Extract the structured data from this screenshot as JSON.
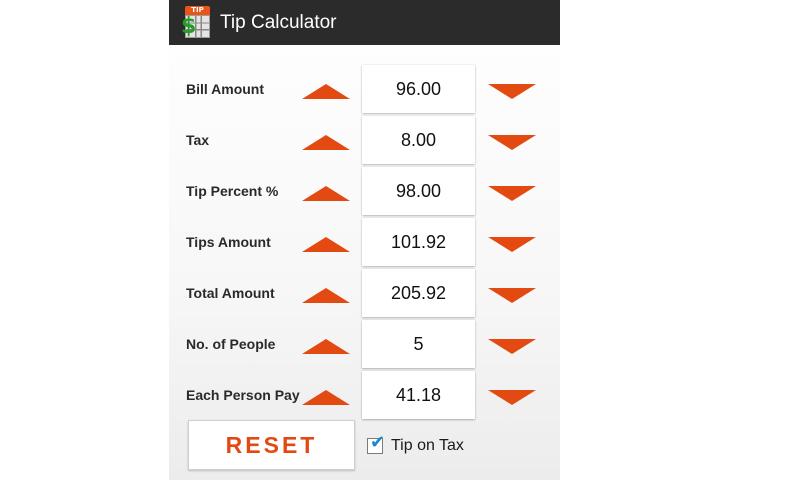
{
  "app": {
    "title": "Tip Calculator",
    "icon_badge": "TIP",
    "icon_symbol": "$",
    "icon_name": "calculator-app-icon"
  },
  "colors": {
    "accent": "#e24a12",
    "actionbar": "#2b2b2b",
    "check": "#1e88c8"
  },
  "rows": [
    {
      "label": "Bill Amount",
      "value": "96.00"
    },
    {
      "label": "Tax",
      "value": "8.00"
    },
    {
      "label": "Tip Percent %",
      "value": "98.00"
    },
    {
      "label": "Tips Amount",
      "value": "101.92"
    },
    {
      "label": "Total Amount",
      "value": "205.92"
    },
    {
      "label": "No. of People",
      "value": "5"
    },
    {
      "label": "Each Person Pay",
      "value": "41.18"
    }
  ],
  "controls": {
    "reset_label": "RESET",
    "tip_on_tax_label": "Tip on Tax",
    "tip_on_tax_checked": true
  }
}
